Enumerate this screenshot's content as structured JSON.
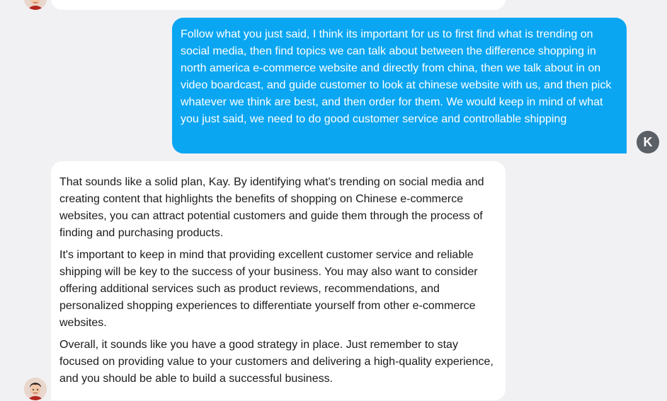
{
  "conversation": {
    "user_initial": "K",
    "user_message": "Follow what you just said, I think its important for us to first find what is trending on social media, then find topics we can talk about between the difference shopping in north america e-commerce website and directly from china, then we talk about in on video boardcast, and guide customer to look at chinese website with us, and then pick whatever we think are best, and then order for them. We would keep in mind of what you just said, we need to do good customer service and controllable shipping",
    "assistant_paragraphs": [
      "That sounds like a solid plan, Kay. By identifying what's trending on social media and creating content that highlights the benefits of shopping on Chinese e-commerce websites, you can attract potential customers and guide them through the process of finding and purchasing products.",
      "It's important to keep in mind that providing excellent customer service and reliable shipping will be key to the success of your business. You may also want to consider offering additional services such as product reviews, recommendations, and personalized shopping experiences to differentiate yourself from other e-commerce websites.",
      "Overall, it sounds like you have a good strategy in place. Just remember to stay focused on providing value to your customers and delivering a high-quality experience, and you should be able to build a successful business."
    ]
  },
  "colors": {
    "background": "#f1f1f3",
    "user_bubble": "#0aa6f2",
    "user_avatar": "#5b5f66",
    "bot_bubble": "#ffffff"
  },
  "icons": {
    "bot_avatar": "cartoon-portrait-avatar"
  }
}
